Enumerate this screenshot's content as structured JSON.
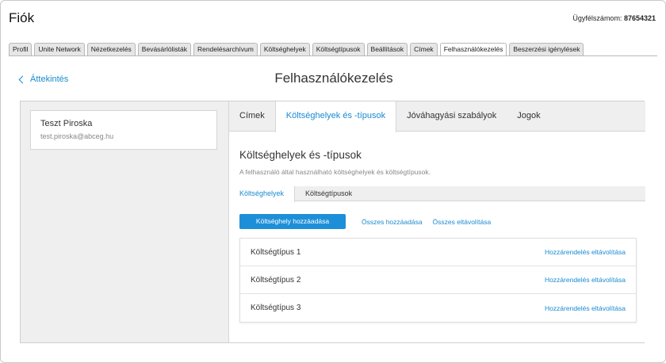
{
  "app": {
    "title": "Fiók",
    "customer_label": "Ügyfélszámom:",
    "customer_number": "87654321"
  },
  "top_tabs": [
    {
      "label": "Profil",
      "active": false
    },
    {
      "label": "Unite Network",
      "active": false
    },
    {
      "label": "Nézetkezelés",
      "active": false
    },
    {
      "label": "Bevásárlólisták",
      "active": false
    },
    {
      "label": "Rendelésarchívum",
      "active": false
    },
    {
      "label": "Költséghelyek",
      "active": false
    },
    {
      "label": "Költségtípusok",
      "active": false
    },
    {
      "label": "Beállítások",
      "active": false
    },
    {
      "label": "Címek",
      "active": false
    },
    {
      "label": "Felhasználókezelés",
      "active": true
    },
    {
      "label": "Beszerzési igénylések",
      "active": false
    }
  ],
  "header": {
    "back_label": "Áttekintés",
    "title": "Felhasználókezelés"
  },
  "user": {
    "name": "Teszt Piroska",
    "email": "test.piroska@abceg.hu"
  },
  "main_tabs": [
    {
      "label": "Címek",
      "active": false
    },
    {
      "label": "Költséghelyek és -típusok",
      "active": true
    },
    {
      "label": "Jóváhagyási szabályok",
      "active": false
    },
    {
      "label": "Jogok",
      "active": false
    }
  ],
  "section": {
    "title": "Költséghelyek és -típusok",
    "description": "A felhasználó által használható költséghelyek és költségtípusok."
  },
  "sub_tabs": [
    {
      "label": "Költséghelyek",
      "active": true
    },
    {
      "label": "Költségtípusok",
      "active": false
    }
  ],
  "actions": {
    "add_button": "Költséghely hozzáadása",
    "add_all": "Összes hozzáadása",
    "remove_all": "Összes eltávolítása"
  },
  "cost_items": [
    {
      "name": "Költségtípus 1",
      "remove_label": "Hozzárendelés eltávolítása"
    },
    {
      "name": "Költségtípus 2",
      "remove_label": "Hozzárendelés eltávolítása"
    },
    {
      "name": "Költségtípus 3",
      "remove_label": "Hozzárendelés eltávolítása"
    }
  ],
  "colors": {
    "accent": "#1d8fd8",
    "link": "#1a8ad0"
  }
}
